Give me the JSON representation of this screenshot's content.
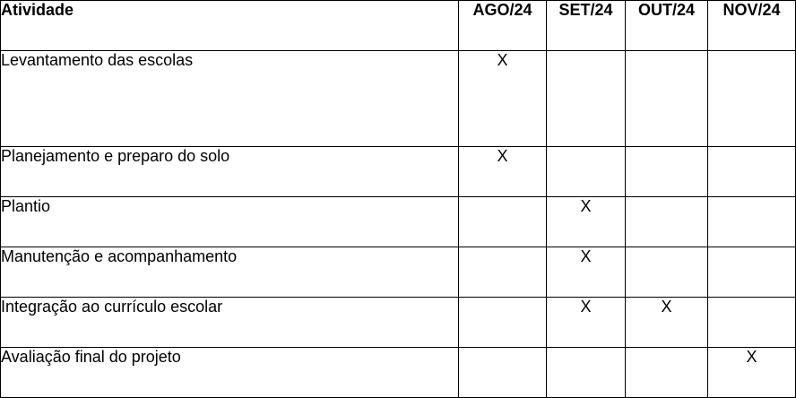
{
  "table": {
    "header": {
      "activity": "Atividade",
      "months": [
        "AGO/24",
        "SET/24",
        "OUT/24",
        "NOV/24"
      ]
    },
    "rows": [
      {
        "activity": "Levantamento das escolas",
        "marks": [
          "X",
          "",
          "",
          ""
        ]
      },
      {
        "activity": "Planejamento e preparo do solo",
        "marks": [
          "X",
          "",
          "",
          ""
        ]
      },
      {
        "activity": "Plantio",
        "marks": [
          "",
          "X",
          "",
          ""
        ]
      },
      {
        "activity": "Manutenção e acompanhamento",
        "marks": [
          "",
          "X",
          "",
          ""
        ]
      },
      {
        "activity": "Integração ao currículo escolar",
        "marks": [
          "",
          "X",
          "X",
          ""
        ]
      },
      {
        "activity": "Avaliação final do projeto",
        "marks": [
          "",
          "",
          "",
          "X"
        ]
      }
    ]
  }
}
